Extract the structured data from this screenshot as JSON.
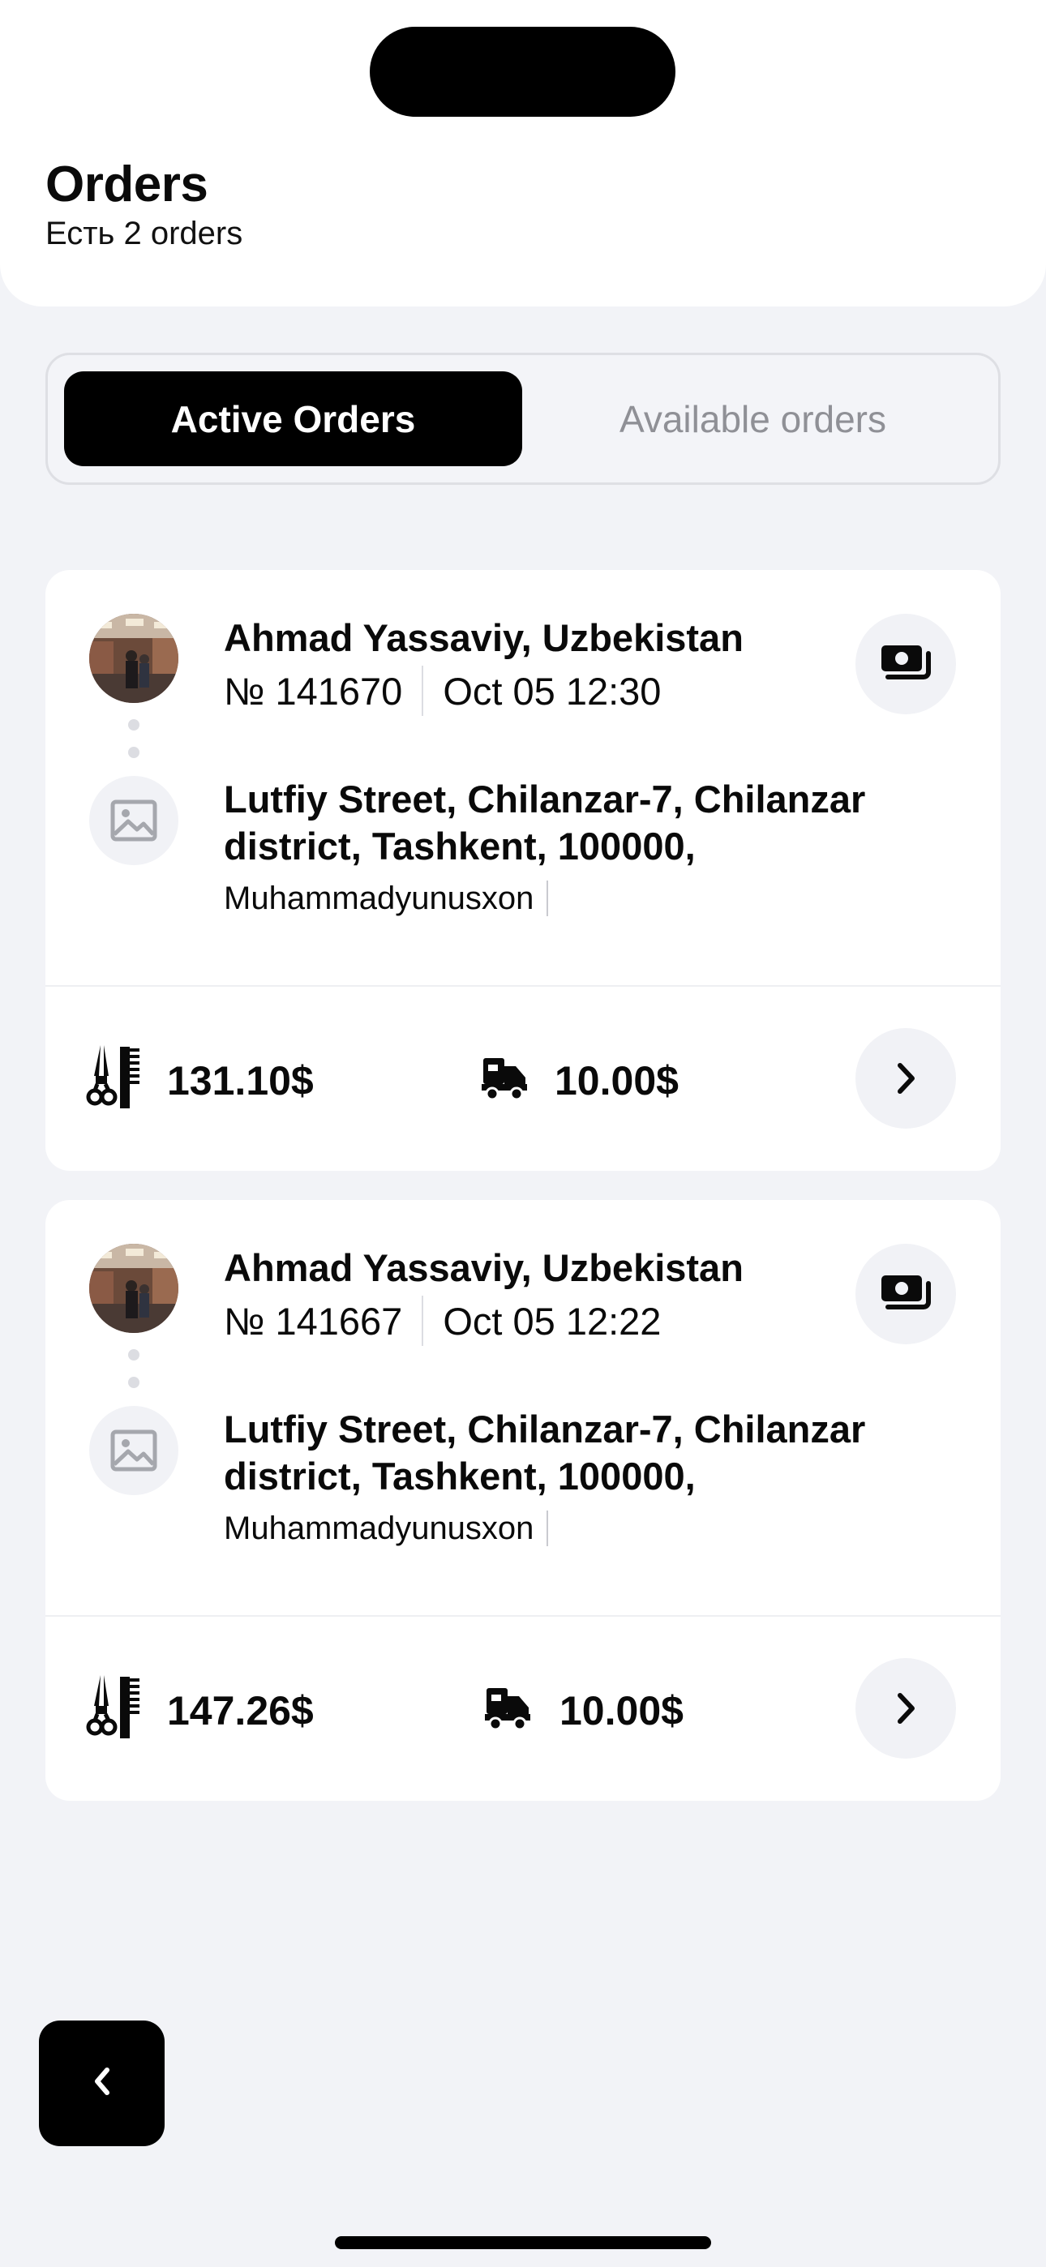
{
  "header": {
    "title": "Orders",
    "subtitle": "Есть 2 orders"
  },
  "tabs": [
    {
      "label": "Active Orders",
      "active": true
    },
    {
      "label": "Available orders",
      "active": false
    }
  ],
  "orders": [
    {
      "store": "Ahmad Yassaviy, Uzbekistan",
      "number": "№ 141670",
      "datetime": "Oct 05 12:30",
      "address": "Lutfiy Street, Chilanzar-7, Chilanzar district, Tashkent, 100000,",
      "customer": "Muhammadyunusxon",
      "goods_total": "131.10$",
      "delivery_fee": "10.00$"
    },
    {
      "store": "Ahmad Yassaviy, Uzbekistan",
      "number": "№ 141667",
      "datetime": "Oct 05 12:22",
      "address": "Lutfiy Street, Chilanzar-7, Chilanzar district, Tashkent, 100000,",
      "customer": "Muhammadyunusxon",
      "goods_total": "147.26$",
      "delivery_fee": "10.00$"
    }
  ],
  "icons": {
    "payment": "cash-icon",
    "goods": "barber-tools-icon",
    "delivery": "delivery-truck-icon",
    "open": "chevron-right-icon",
    "back": "chevron-left-icon",
    "address_image": "image-placeholder-icon"
  },
  "colors": {
    "background": "#f2f3f7",
    "card": "#ffffff",
    "accent": "#000000",
    "inactive_text": "#8f9096",
    "icon_circle": "#f1f2f6"
  }
}
